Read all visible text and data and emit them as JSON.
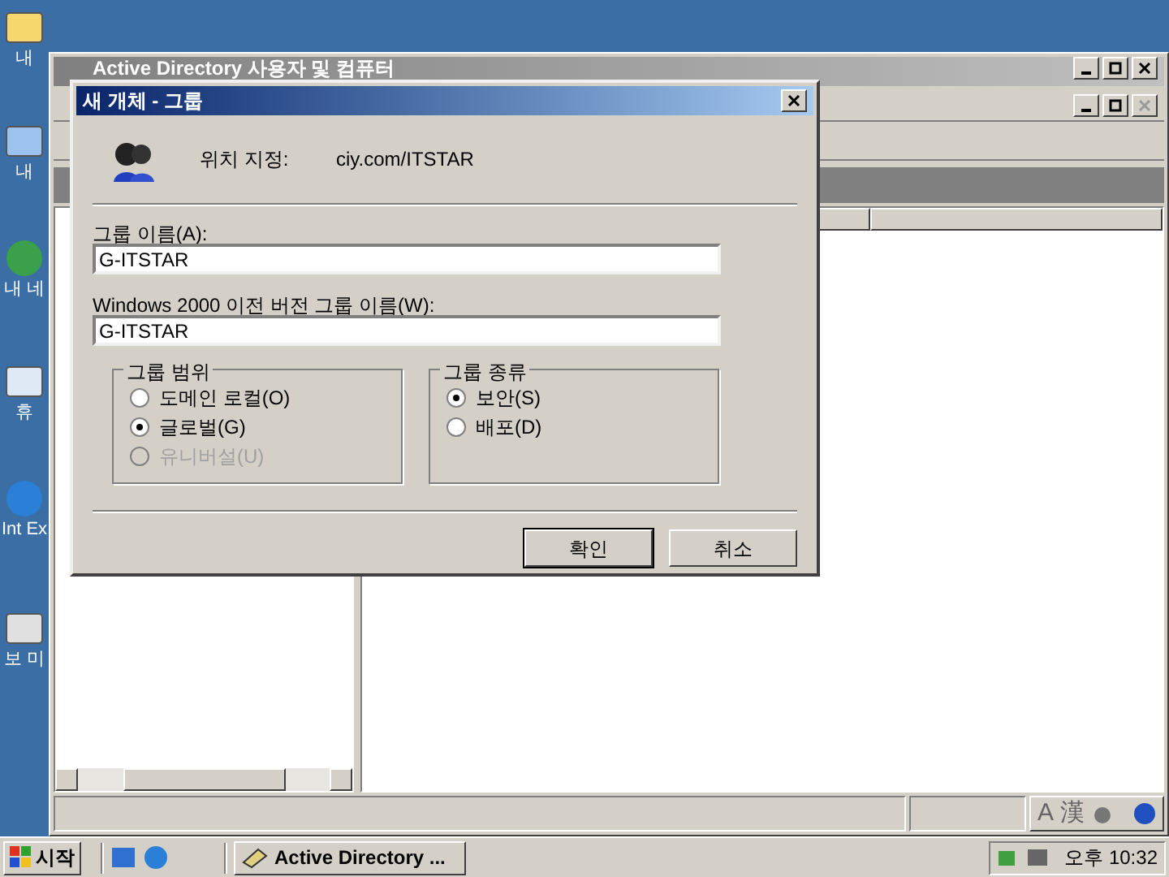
{
  "desktop_icons": [
    {
      "kind": "folder",
      "label": "내"
    },
    {
      "kind": "computer",
      "label": "내"
    },
    {
      "kind": "globe",
      "label": "내 네"
    },
    {
      "kind": "recycle",
      "label": "휴"
    },
    {
      "kind": "browser",
      "label": "Int Ex"
    },
    {
      "kind": "shortcut",
      "label": "보 미"
    }
  ],
  "main_window": {
    "title": "Active Directory 사용자 및 컴퓨터",
    "active": false
  },
  "dialog": {
    "title": "새 개체 - 그룹",
    "location_label": "위치 지정:",
    "location": "ciy.com/ITSTAR",
    "fields": [
      {
        "label": "그룹 이름(A):",
        "value": "G-ITSTAR"
      },
      {
        "label": "Windows 2000 이전 버전 그룹 이름(W):",
        "value": "G-ITSTAR"
      }
    ],
    "groups": [
      {
        "title": "그룹 범위",
        "options": [
          {
            "label": "도메인 로컬(O)",
            "selected": false,
            "disabled": false
          },
          {
            "label": "글로벌(G)",
            "selected": true,
            "disabled": false
          },
          {
            "label": "유니버설(U)",
            "selected": false,
            "disabled": true
          }
        ]
      },
      {
        "title": "그룹 종류",
        "options": [
          {
            "label": "보안(S)",
            "selected": true,
            "disabled": false
          },
          {
            "label": "배포(D)",
            "selected": false,
            "disabled": false
          }
        ]
      }
    ],
    "buttons": [
      {
        "label": "확인",
        "default": true
      },
      {
        "label": "취소",
        "default": false
      }
    ]
  },
  "status_bar": {
    "ime": [
      "A",
      "漢"
    ]
  },
  "taskbar": {
    "start": "시작",
    "tasks": [
      {
        "label": "Active Directory ...",
        "selected": false
      }
    ],
    "clock": "오후 10:32"
  }
}
